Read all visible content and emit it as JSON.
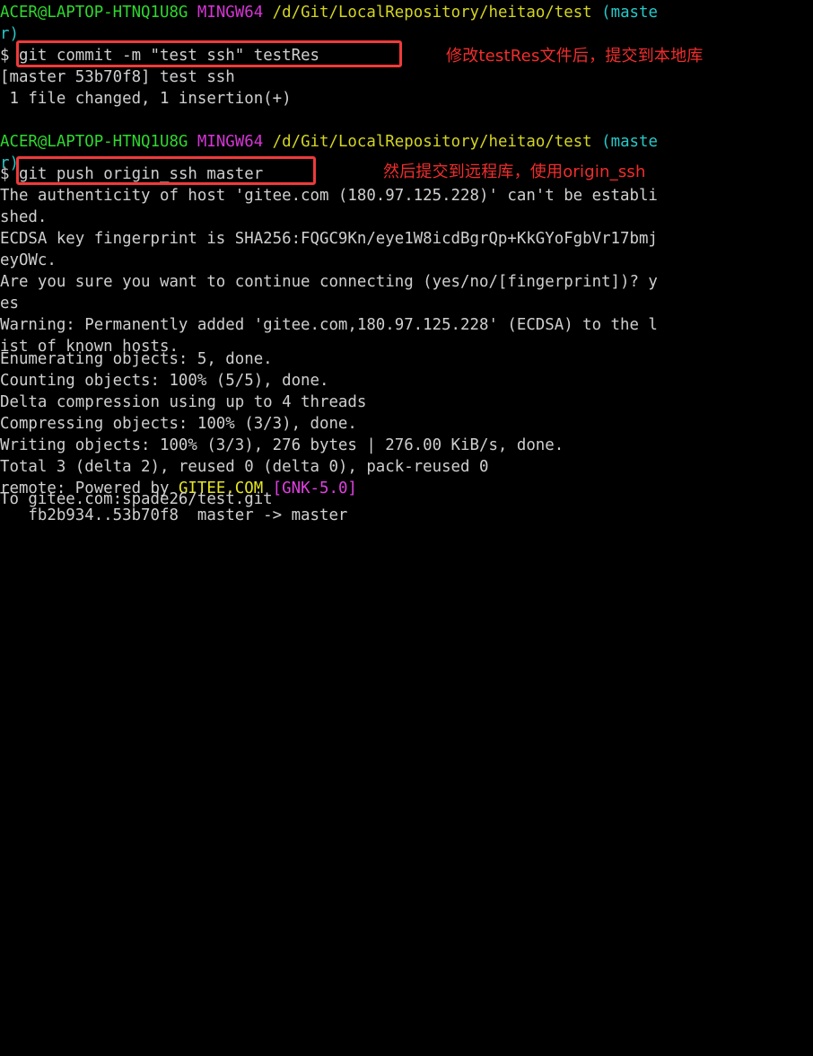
{
  "terminal": {
    "shell": "MINGW64",
    "background_color": "#000000",
    "prompt_user": "ACER@LAPTOP-HTNQ1U8G",
    "prompt_shell": "MINGW64",
    "prompt_path": "/d/Git/LocalRepository/heitao/test",
    "prompt_branch_part1": "(maste",
    "prompt_branch_part2": "r)",
    "prompt_symbol": "$",
    "colors": {
      "user": "#2fd82f",
      "shell": "#d634d6",
      "path": "#d4d422",
      "branch": "#28c7c7",
      "output": "#cfcfcf",
      "annotation": "#f22d2d",
      "highlight_box": "#f03a3a",
      "gitee": "#e6e622",
      "gnk": "#e040e0"
    },
    "commands": {
      "commit": "git commit -m \"test ssh\" testRes",
      "push": "git push origin_ssh master"
    },
    "output_lines": [
      "[master 53b70f8] test ssh",
      " 1 file changed, 1 insertion(+)",
      "The authenticity of host 'gitee.com (180.97.125.228)' can't be establi",
      "shed.",
      "ECDSA key fingerprint is SHA256:FQGC9Kn/eye1W8icdBgrQp+KkGYoFgbVr17bmj",
      "eyOWc.",
      "Are you sure you want to continue connecting (yes/no/[fingerprint])? y",
      "es",
      "Warning: Permanently added 'gitee.com,180.97.125.228' (ECDSA) to the l",
      "ist of known hosts.",
      "Enumerating objects: 5, done.",
      "Counting objects: 100% (5/5), done.",
      "Delta compression using up to 4 threads",
      "Compressing objects: 100% (3/3), done.",
      "Writing objects: 100% (3/3), 276 bytes | 276.00 KiB/s, done.",
      "Total 3 (delta 2), reused 0 (delta 0), pack-reused 0"
    ],
    "remote_line": {
      "prefix": "remote: Powered by ",
      "gitee": "GITEE.COM",
      "space": " ",
      "gnk": "[GNK-5.0]"
    },
    "to_line": "To gitee.com:spade26/test.git",
    "ref_update_line": "   fb2b934..53b70f8  master -> master"
  },
  "annotations": [
    {
      "text": "修改testRes文件后，提交到本地库"
    },
    {
      "text": "然后提交到远程库，使用origin_ssh"
    }
  ]
}
